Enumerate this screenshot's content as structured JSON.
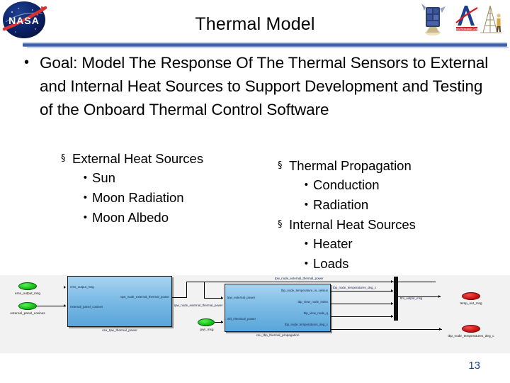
{
  "header": {
    "title": "Thermal Model",
    "nasa_logo_alt": "NASA insignia",
    "ames_logo_text": "Ames Research Center",
    "spacecraft_logo_alt": "spacecraft illustration",
    "structure_logo_alt": "test structure illustration"
  },
  "body": {
    "main_bullet": {
      "marker": "•",
      "text": "Goal: Model The Response Of The Thermal Sensors to External and Internal Heat Sources to Support Development and Testing of the Onboard Thermal Control Software"
    },
    "left_column": [
      {
        "level": 1,
        "marker": "§",
        "label": "External Heat Sources"
      },
      {
        "level": 2,
        "marker": "•",
        "label": "Sun"
      },
      {
        "level": 2,
        "marker": "•",
        "label": "Moon Radiation"
      },
      {
        "level": 2,
        "marker": "•",
        "label": "Moon Albedo"
      }
    ],
    "right_column": [
      {
        "level": 1,
        "marker": "§",
        "label": "Thermal Propagation"
      },
      {
        "level": 2,
        "marker": "•",
        "label": "Conduction"
      },
      {
        "level": 2,
        "marker": "•",
        "label": "Radiation"
      },
      {
        "level": 1,
        "marker": "§",
        "label": "Internal Heat Sources"
      },
      {
        "level": 2,
        "marker": "•",
        "label": "Heater"
      },
      {
        "level": 2,
        "marker": "•",
        "label": "Loads"
      }
    ]
  },
  "diagram": {
    "terminals": [
      {
        "id": "t1",
        "kind": "in",
        "label": "ems_output_msg"
      },
      {
        "id": "t2",
        "kind": "in",
        "label": "external_panel_cosines"
      },
      {
        "id": "t3",
        "kind": "in",
        "label": "pwr_msg"
      },
      {
        "id": "t4",
        "kind": "out",
        "label": "temp_out_msg"
      },
      {
        "id": "t5",
        "kind": "out",
        "label": "tbp_node_temperatures_deg_c"
      }
    ],
    "blocks": [
      {
        "id": "b1",
        "name": "csu_tpw_thermal_power",
        "inputs": [
          "ems_output_msg",
          "external_panel_cosines"
        ],
        "outputs": [
          "tpw_node_external_thermal_power"
        ]
      },
      {
        "id": "b2",
        "name": "csu_tbp_thermal_propagation",
        "inputs": [
          "tpw_external_power",
          "eld_electrical_power"
        ],
        "outputs": [
          "tbp_node_temperature_in_celsius",
          "tbp_view_node_index",
          "tbp_view_node_q",
          "tbp_node_temperatures_deg_c"
        ]
      }
    ],
    "signals": [
      "tpw_node_external_thermal_power",
      "tbp_node_temperatures_deg_c"
    ],
    "mux_label": "tlm_output_msg"
  },
  "footer": {
    "page_number": "13"
  }
}
